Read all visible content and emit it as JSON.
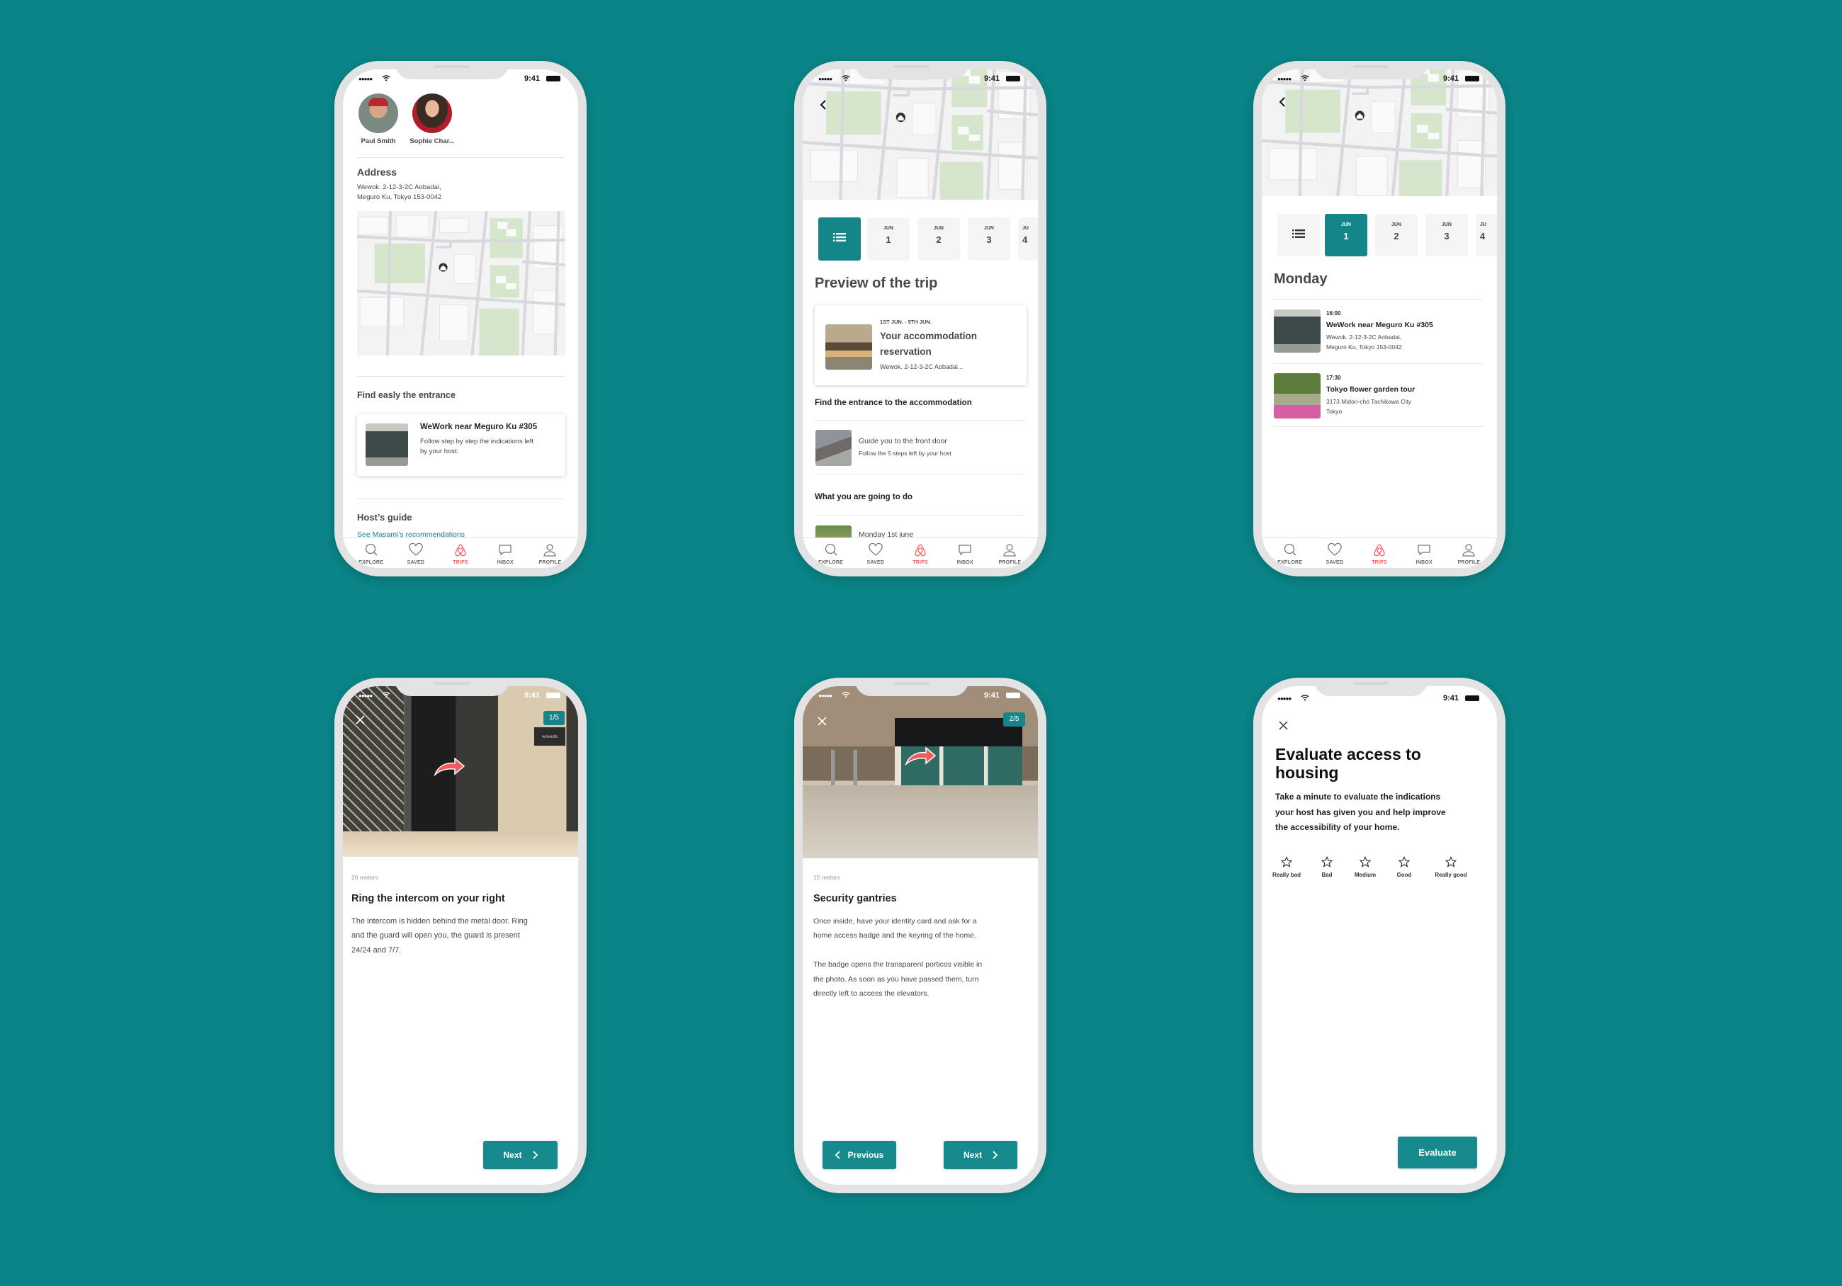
{
  "colors": {
    "background": "#0a8487",
    "accent": "#148589",
    "trips_active": "#ff5a5f"
  },
  "status_bar": {
    "time": "9:41"
  },
  "tabbar": {
    "items": [
      {
        "label": "EXPLORE",
        "icon": "search-icon"
      },
      {
        "label": "SAVED",
        "icon": "heart-icon"
      },
      {
        "label": "TRIPS",
        "icon": "airbnb-logo-icon",
        "active": true
      },
      {
        "label": "INBOX",
        "icon": "chat-icon"
      },
      {
        "label": "PROFILE",
        "icon": "person-icon"
      }
    ]
  },
  "screen1": {
    "guests": [
      {
        "name": "Paul Smith"
      },
      {
        "name": "Sophie Char..."
      }
    ],
    "address_title": "Address",
    "address_lines": [
      "Wewok. 2-12-3-2C Aobadai,",
      "Meguro Ku, Tokyo 153-0042"
    ],
    "entrance_title": "Find easly the entrance",
    "entrance_card": {
      "title": "WeWork near Meguro Ku #305",
      "desc_lines": [
        "Follow step by step the indications left",
        "by your host."
      ]
    },
    "hosts_guide_title": "Host’s guide",
    "hosts_guide_link": "See Masami's recommendations"
  },
  "screen2": {
    "dates": [
      {
        "month": "JUN",
        "day": "1"
      },
      {
        "month": "JUN",
        "day": "2"
      },
      {
        "month": "JUN",
        "day": "3"
      },
      {
        "month": "JU",
        "day": "4"
      }
    ],
    "title": "Preview of the trip",
    "reservation": {
      "dates": "1ST JUN. - 5TH JUN.",
      "title_lines": [
        "Your accommodation",
        "reservation"
      ],
      "address": "Wewok. 2-12-3-2C Aobadai..."
    },
    "entrance_title": "Find the entrance to the accommodation",
    "guide": {
      "title": "Guide you to the front door",
      "subtitle": "Follow the 5 steps left by your host"
    },
    "todo_title": "What you are going to do",
    "todo_first": "Monday 1st june"
  },
  "screen3": {
    "dates": [
      {
        "month": "JUN",
        "day": "1"
      },
      {
        "month": "JUN",
        "day": "2"
      },
      {
        "month": "JUN",
        "day": "3"
      },
      {
        "month": "JU",
        "day": "4"
      }
    ],
    "day_title": "Monday",
    "events": [
      {
        "time": "16:00",
        "title": "WeWork near Meguro Ku #305",
        "address_lines": [
          "Wewok. 2-12-3-2C Aobadai,",
          "Meguro Ku, Tokyo 153-0042"
        ]
      },
      {
        "time": "17:30",
        "title": "Tokyo flower garden tour",
        "address_lines": [
          "3173 Midori-cho Tachikawa City",
          "Tokyo"
        ]
      }
    ]
  },
  "screen4": {
    "step": "1/5",
    "distance": "20 meters",
    "title": "Ring the intercom on your right",
    "body_lines": [
      "The intercom is hidden behind the metal door. Ring",
      "and the guard will open you, the guard is present",
      "24/24 and 7/7."
    ],
    "photo_sign": "wework",
    "next_label": "Next"
  },
  "screen5": {
    "step": "2/5",
    "distance": "15 meters",
    "title": "Security gantries",
    "body_lines": [
      "Once inside, have your identity card and ask for a",
      "home access badge and the keyring of the home."
    ],
    "body_lines_2": [
      "The badge opens the transparent porticos visible in",
      "the photo. As soon as you have passed them, turn",
      "directly left to access the elevators."
    ],
    "previous_label": "Previous",
    "next_label": "Next"
  },
  "screen6": {
    "title_lines": [
      "Evaluate access to",
      "housing"
    ],
    "desc_lines": [
      "Take a minute to evaluate the indications",
      "your host has given you and help improve",
      "the accessibility of your home."
    ],
    "ratings": [
      "Really bad",
      "Bad",
      "Medium",
      "Good",
      "Really good"
    ],
    "selected_rating": 0,
    "evaluate_label": "Evaluate"
  }
}
